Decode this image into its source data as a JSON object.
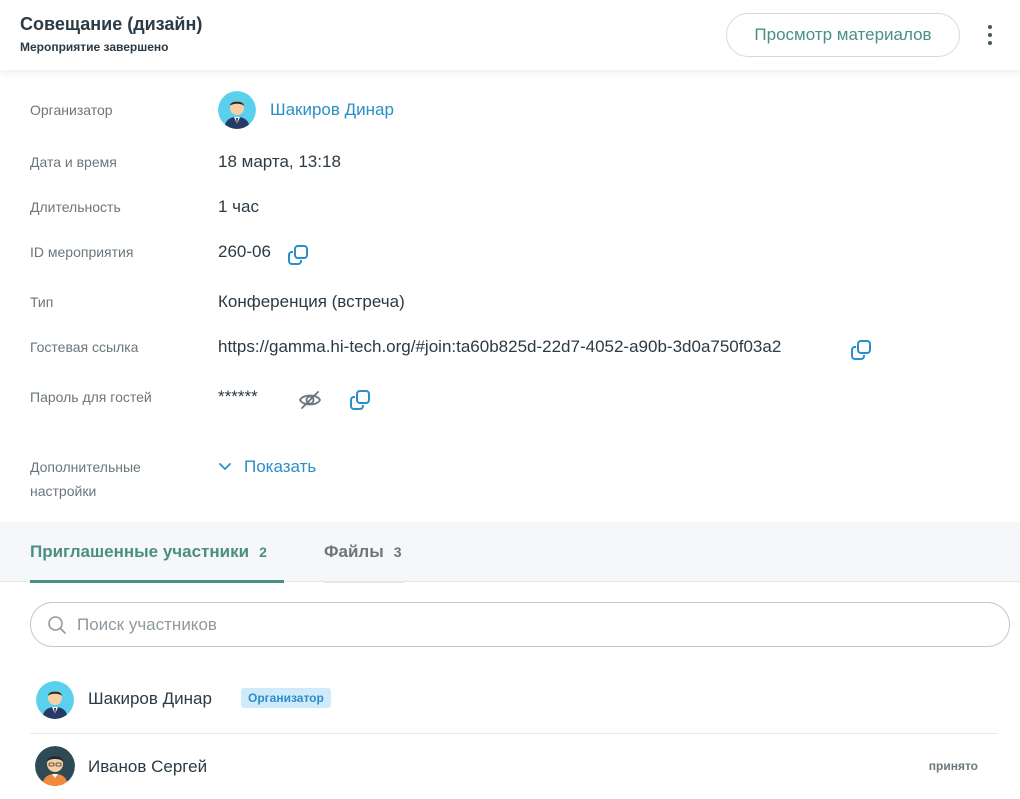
{
  "header": {
    "title": "Совещание (дизайн)",
    "subtitle": "Мероприятие завершено",
    "materials_button": "Просмотр материалов",
    "more_icon": "more-vertical-icon"
  },
  "details": {
    "organizer": {
      "label": "Организатор",
      "name": "Шакиров Динар"
    },
    "datetime": {
      "label": "Дата и время",
      "value": "18 марта, 13:18"
    },
    "duration": {
      "label": "Длительность",
      "value": "1 час"
    },
    "event_id": {
      "label": "ID мероприятия",
      "value": "260-06"
    },
    "type": {
      "label": "Тип",
      "value": "Конференция (встреча)"
    },
    "guest_link": {
      "label": "Гостевая ссылка",
      "value": "https://gamma.hi-tech.org/#join:ta60b825d-22d7-4052-a90b-3d0a750f03a2"
    },
    "guest_password": {
      "label": "Пароль для гостей",
      "value": "******"
    },
    "extra_settings": {
      "label_line1": "Дополнительные",
      "label_line2": "настройки",
      "show_label": "Показать"
    }
  },
  "tabs": [
    {
      "label": "Приглашенные участники",
      "count": "2",
      "active": true
    },
    {
      "label": "Файлы",
      "count": "3",
      "active": false
    }
  ],
  "search": {
    "placeholder": "Поиск участников"
  },
  "participants": [
    {
      "name": "Шакиров Динар",
      "badge": "Организатор",
      "status": ""
    },
    {
      "name": "Иванов Сергей",
      "badge": "",
      "status": "принято"
    }
  ],
  "colors": {
    "accent": "#4a8f84",
    "link": "#2a8ec8",
    "badge_bg": "#cfeafb"
  }
}
